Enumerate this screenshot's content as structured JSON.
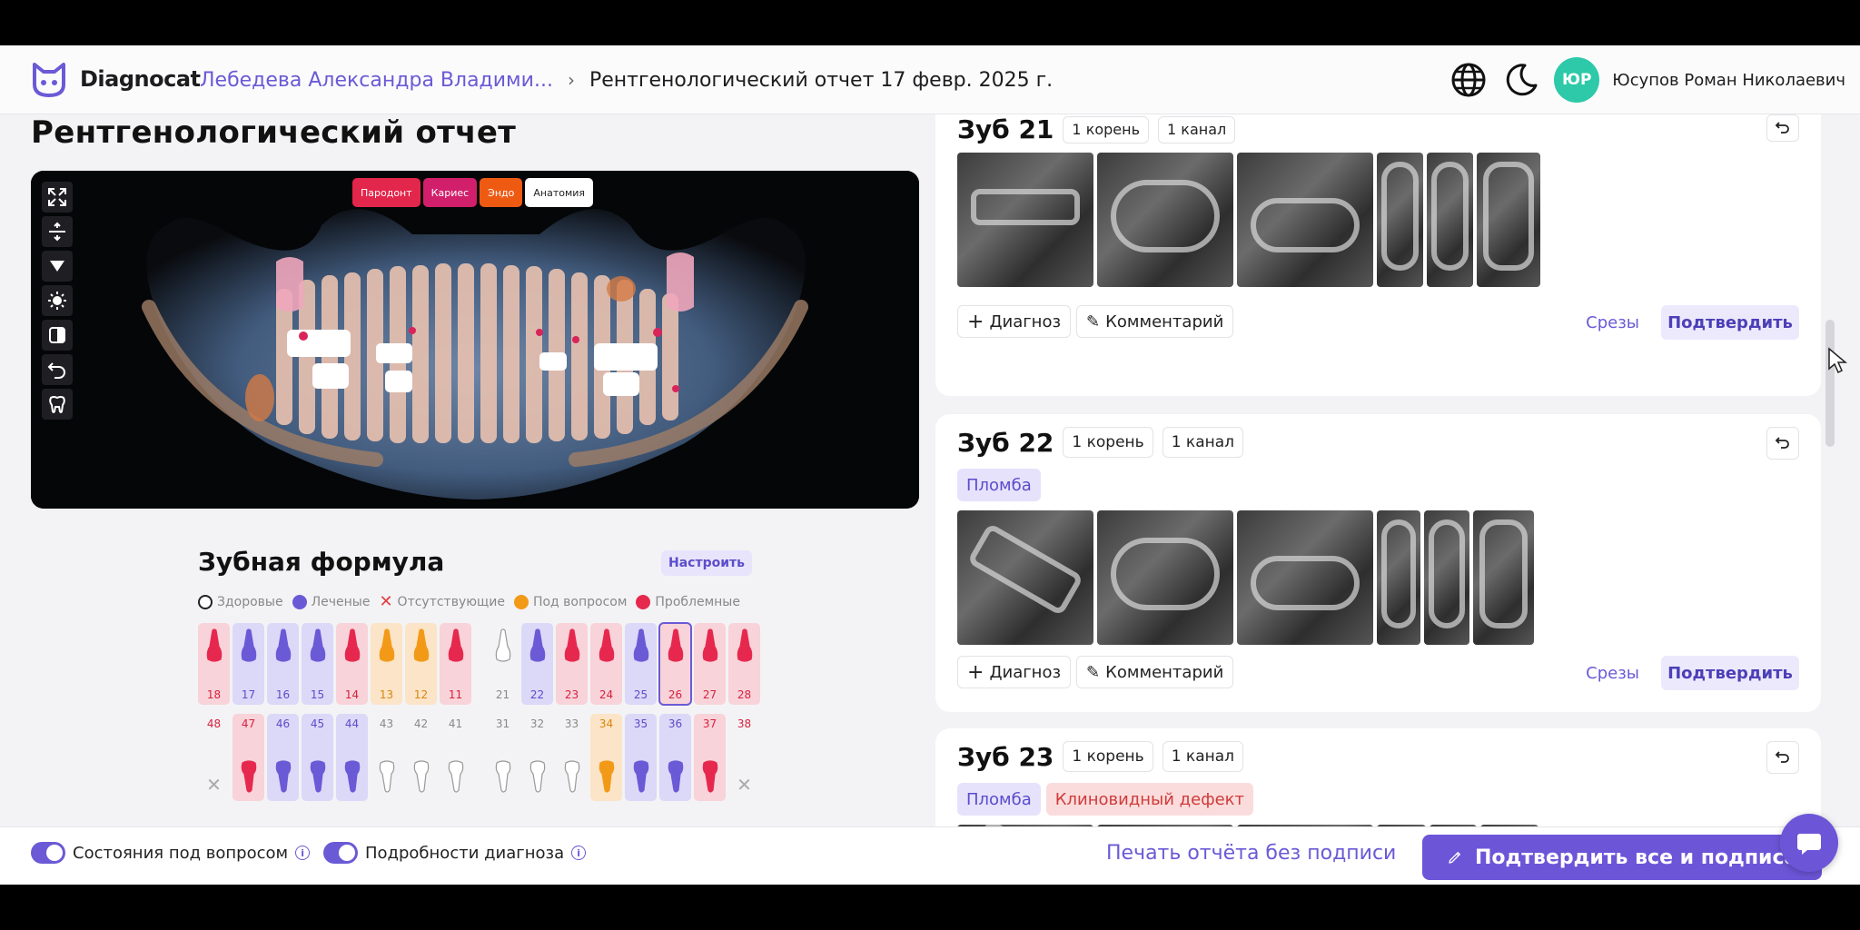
{
  "app": {
    "brand": "Diagnocat"
  },
  "breadcrumb": {
    "patient": "Лебедева Александра Владими...",
    "separator": "›",
    "document": "Рентгенологический отчет 17 февр. 2025 г."
  },
  "user": {
    "initials": "ЮР",
    "name": "Юсупов Роман Николаевич"
  },
  "page": {
    "title": "Рентгенологический отчет"
  },
  "xray": {
    "layers": [
      {
        "label": "Пародонт",
        "color": "#e3264b"
      },
      {
        "label": "Кариес",
        "color": "#d11f6b"
      },
      {
        "label": "Эндо",
        "color": "#ef5a13"
      },
      {
        "label": "Анатомия",
        "color": "#ffffff"
      }
    ],
    "tools": [
      "fullscreen-icon",
      "split-icon",
      "filter-icon",
      "brightness-icon",
      "contrast-icon",
      "undo-icon",
      "tooth-icon"
    ]
  },
  "formula": {
    "title": "Зубная формула",
    "configure_label": "Настроить",
    "legend": [
      {
        "label": "Здоровые",
        "color": "#ffffff"
      },
      {
        "label": "Леченые",
        "color": "#6a5ad6"
      },
      {
        "label": "Отсутствующие",
        "color": "#e53d3d"
      },
      {
        "label": "Под вопросом",
        "color": "#f29a18"
      },
      {
        "label": "Проблемные",
        "color": "#e6284f"
      }
    ],
    "upper": [
      {
        "num": "18",
        "status": "problem"
      },
      {
        "num": "17",
        "status": "treated"
      },
      {
        "num": "16",
        "status": "treated"
      },
      {
        "num": "15",
        "status": "treated"
      },
      {
        "num": "14",
        "status": "problem"
      },
      {
        "num": "13",
        "status": "question"
      },
      {
        "num": "12",
        "status": "question"
      },
      {
        "num": "11",
        "status": "problem"
      },
      {
        "num": "21",
        "status": "healthy"
      },
      {
        "num": "22",
        "status": "treated"
      },
      {
        "num": "23",
        "status": "problem"
      },
      {
        "num": "24",
        "status": "problem"
      },
      {
        "num": "25",
        "status": "treated"
      },
      {
        "num": "26",
        "status": "problem",
        "selected": true
      },
      {
        "num": "27",
        "status": "problem"
      },
      {
        "num": "28",
        "status": "problem"
      }
    ],
    "lower": [
      {
        "num": "48",
        "status": "missing"
      },
      {
        "num": "47",
        "status": "problem"
      },
      {
        "num": "46",
        "status": "treated"
      },
      {
        "num": "45",
        "status": "treated"
      },
      {
        "num": "44",
        "status": "treated"
      },
      {
        "num": "43",
        "status": "healthy"
      },
      {
        "num": "42",
        "status": "healthy"
      },
      {
        "num": "41",
        "status": "healthy"
      },
      {
        "num": "31",
        "status": "healthy"
      },
      {
        "num": "32",
        "status": "healthy"
      },
      {
        "num": "33",
        "status": "healthy"
      },
      {
        "num": "34",
        "status": "question"
      },
      {
        "num": "35",
        "status": "treated"
      },
      {
        "num": "36",
        "status": "treated"
      },
      {
        "num": "37",
        "status": "problem"
      },
      {
        "num": "38",
        "status": "missing"
      }
    ]
  },
  "cards": [
    {
      "title": "Зуб 21",
      "roots": "1 корень",
      "canals": "1 канал",
      "tags": [],
      "add_diagnosis": "Диагноз",
      "comment": "Комментарий",
      "slices_label": "Срезы",
      "confirm_label": "Подтвердить"
    },
    {
      "title": "Зуб 22",
      "roots": "1 корень",
      "canals": "1 канал",
      "tags": [
        {
          "label": "Пломба",
          "kind": "fill"
        }
      ],
      "add_diagnosis": "Диагноз",
      "comment": "Комментарий",
      "slices_label": "Срезы",
      "confirm_label": "Подтвердить"
    },
    {
      "title": "Зуб 23",
      "roots": "1 корень",
      "canals": "1 канал",
      "tags": [
        {
          "label": "Пломба",
          "kind": "fill"
        },
        {
          "label": "Клиновидный дефект",
          "kind": "defect"
        }
      ]
    }
  ],
  "footer": {
    "toggle_questionable": "Состояния под вопросом",
    "toggle_details": "Подробности диагноза",
    "print_link": "Печать отчёта без подписи",
    "sign_all": "Подтвердить все и подписать"
  }
}
